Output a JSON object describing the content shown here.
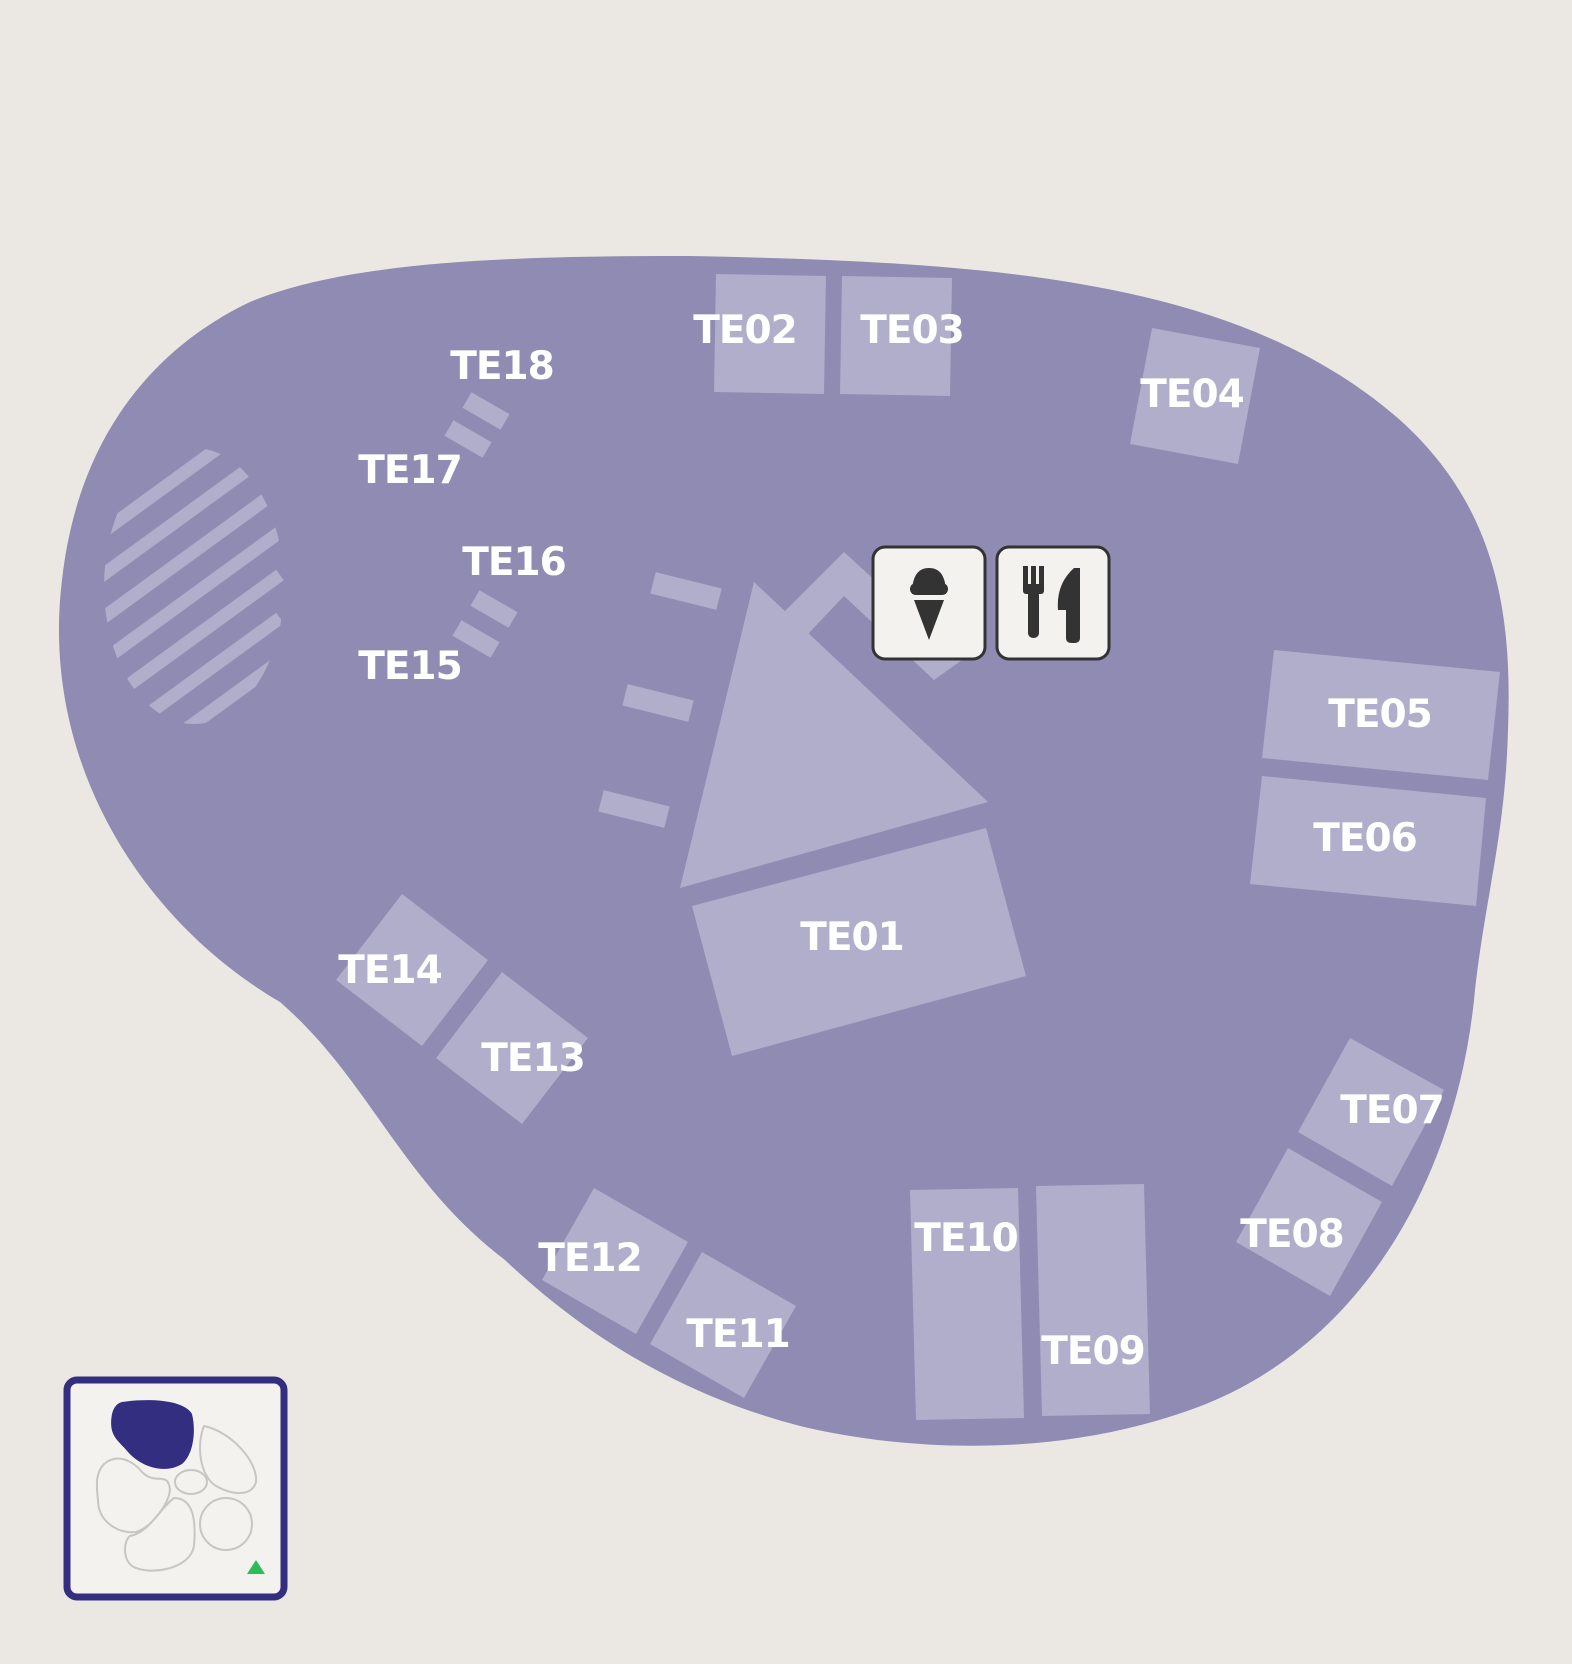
{
  "map": {
    "colors": {
      "background": "#ebe8e3",
      "zone": "#8f8bb2",
      "stall": "#b0aeca",
      "label": "#ffffff",
      "inset_frame": "#332e80",
      "inset_active": "#332e80",
      "inset_outline": "#c8c6c2",
      "north_marker": "#2bbd5a"
    },
    "stalls": [
      "TE01",
      "TE02",
      "TE03",
      "TE04",
      "TE05",
      "TE06",
      "TE07",
      "TE08",
      "TE09",
      "TE10",
      "TE11",
      "TE12",
      "TE13",
      "TE14",
      "TE15",
      "TE16",
      "TE17",
      "TE18"
    ],
    "amenities": [
      {
        "name": "ice-cream",
        "icon": "ice-cream-icon"
      },
      {
        "name": "restaurant",
        "icon": "fork-knife-icon"
      }
    ],
    "inset": {
      "active_zone": "north-west",
      "north_icon": "north-arrow-icon"
    }
  }
}
